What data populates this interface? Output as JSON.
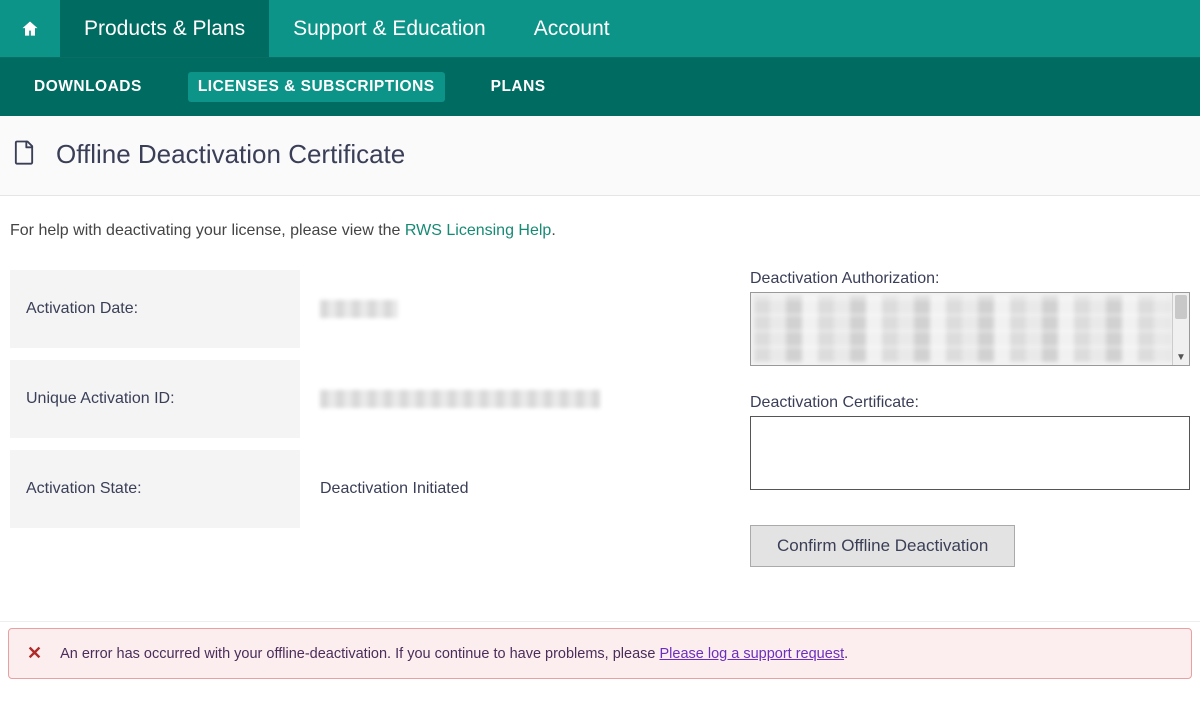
{
  "topnav": {
    "items": [
      {
        "label": "Products & Plans",
        "active": true
      },
      {
        "label": "Support & Education",
        "active": false
      },
      {
        "label": "Account",
        "active": false
      }
    ]
  },
  "subnav": {
    "items": [
      {
        "label": "DOWNLOADS",
        "active": false
      },
      {
        "label": "LICENSES & SUBSCRIPTIONS",
        "active": true
      },
      {
        "label": "PLANS",
        "active": false
      }
    ]
  },
  "page": {
    "title": "Offline Deactivation Certificate",
    "help_prefix": "For help with deactivating your license, please view the ",
    "help_link_text": "RWS Licensing Help",
    "help_suffix": "."
  },
  "left_fields": {
    "activation_date_label": "Activation Date:",
    "activation_date_value": "",
    "unique_activation_id_label": "Unique Activation ID:",
    "unique_activation_id_value": "",
    "activation_state_label": "Activation State:",
    "activation_state_value": "Deactivation Initiated"
  },
  "right_panel": {
    "auth_label": "Deactivation Authorization:",
    "auth_value": "",
    "cert_label": "Deactivation Certificate:",
    "cert_value": "",
    "confirm_button": "Confirm Offline Deactivation"
  },
  "error": {
    "message_prefix": "An error has occurred with your offline-deactivation. If you continue to have problems, please ",
    "link_text": "Please log a support request",
    "message_suffix": "."
  }
}
